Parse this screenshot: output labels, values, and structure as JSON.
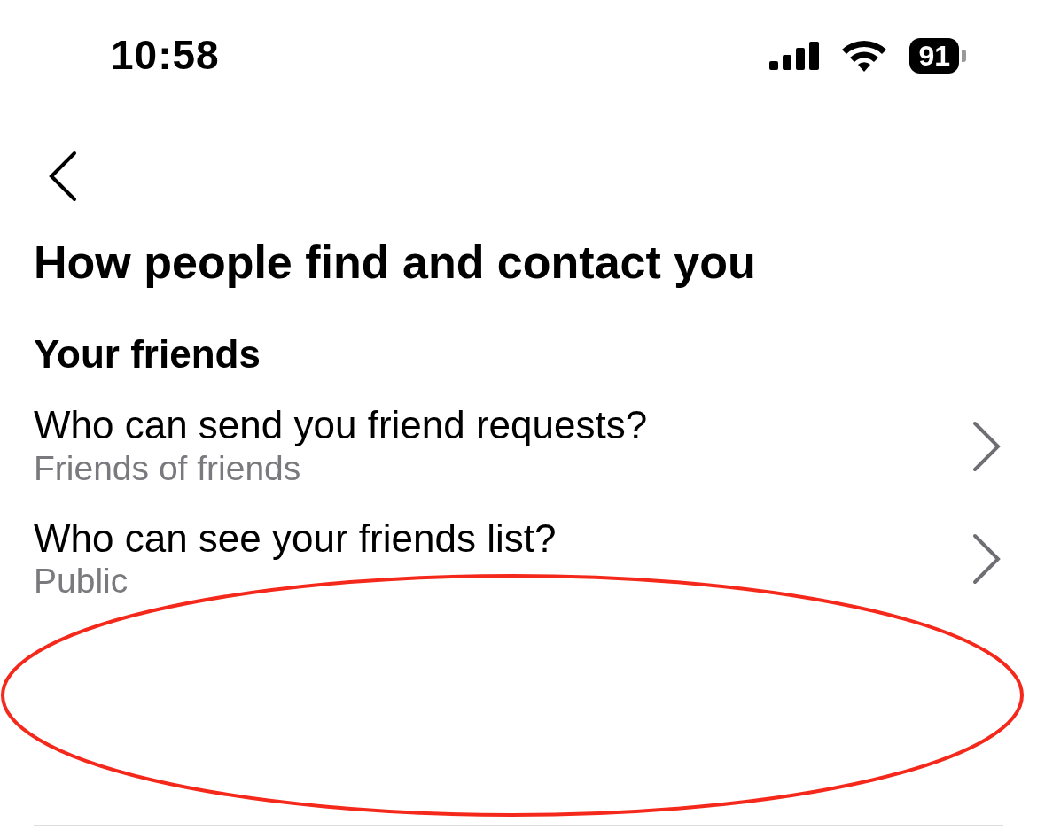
{
  "status_bar": {
    "time": "10:58",
    "battery": "91"
  },
  "heading": "How people find and contact you",
  "section_title": "Your friends",
  "settings": [
    {
      "title": "Who can send you friend requests?",
      "value": "Friends of friends"
    },
    {
      "title": "Who can see your friends list?",
      "value": "Public"
    }
  ]
}
